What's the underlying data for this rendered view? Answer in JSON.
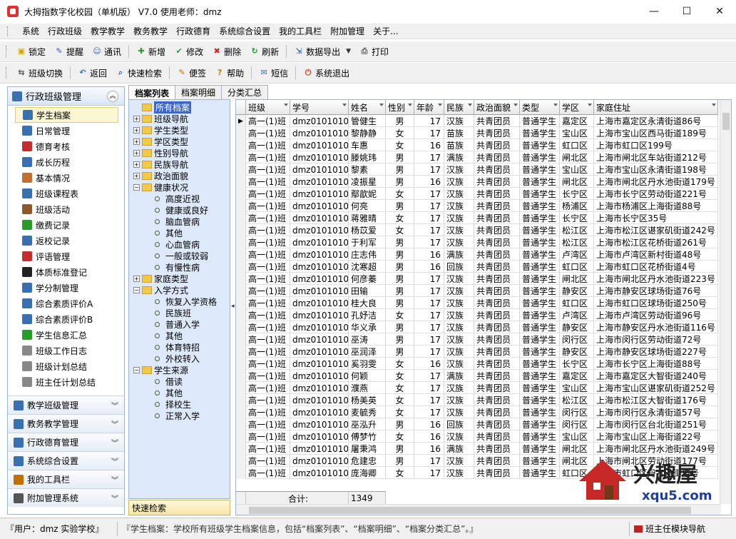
{
  "window": {
    "title": "大拇指数字化校园（单机版）  V7.0  使用老师：dmz",
    "controls": {
      "minimize": "—",
      "maximize": "☐",
      "close": "✕"
    }
  },
  "menu": [
    "系统",
    "行政班级",
    "教学教学",
    "教务教学",
    "行政德育",
    "系统综合设置",
    "我的工具栏",
    "附加管理",
    "关于..."
  ],
  "toolbar1": [
    {
      "label": "锁定",
      "icon": "lock-icon",
      "color": "#d9a400",
      "glyph": "▣"
    },
    {
      "label": "提醒",
      "icon": "reminder-icon",
      "color": "#3060c0",
      "glyph": "✎"
    },
    {
      "label": "通讯",
      "icon": "contacts-icon",
      "color": "#3060c0",
      "glyph": "☺"
    },
    {
      "label": "新增",
      "icon": "add-icon",
      "color": "#2a9a2a",
      "glyph": "✚"
    },
    {
      "label": "修改",
      "icon": "edit-icon",
      "color": "#2a9a2a",
      "glyph": "✔"
    },
    {
      "label": "删除",
      "icon": "delete-icon",
      "color": "#d02020",
      "glyph": "✖"
    },
    {
      "label": "刷新",
      "icon": "refresh-icon",
      "color": "#2a9a2a",
      "glyph": "↻"
    },
    {
      "label": "数据导出",
      "icon": "export-icon",
      "color": "#3a6fb0",
      "glyph": "⇲"
    },
    {
      "label": "打印",
      "icon": "print-icon",
      "color": "#555555",
      "glyph": "⎙"
    }
  ],
  "toolbar2": [
    {
      "label": "班级切换",
      "icon": "class-switch-icon",
      "color": "#555555",
      "glyph": "⇆"
    },
    {
      "label": "返回",
      "icon": "back-icon",
      "color": "#3a6fb0",
      "glyph": "↶"
    },
    {
      "label": "快速检索",
      "icon": "search-icon",
      "color": "#3a6fb0",
      "glyph": "⌕"
    },
    {
      "label": "便签",
      "icon": "note-icon",
      "color": "#c07000",
      "glyph": "✎"
    },
    {
      "label": "帮助",
      "icon": "help-icon",
      "color": "#c08000",
      "glyph": "?"
    },
    {
      "label": "短信",
      "icon": "sms-icon",
      "color": "#3a6fb0",
      "glyph": "✉"
    },
    {
      "label": "系统退出",
      "icon": "exit-icon",
      "color": "#d04010",
      "glyph": "⏻"
    }
  ],
  "sidebar": {
    "header": "行政班级管理",
    "items": [
      {
        "label": "学生档案",
        "icon": "student-file-icon",
        "color": "#3a6fb0"
      },
      {
        "label": "日常管理",
        "icon": "clock-icon",
        "color": "#3a6fb0"
      },
      {
        "label": "德育考核",
        "icon": "moral-check-icon",
        "color": "#c03030"
      },
      {
        "label": "成长历程",
        "icon": "growth-icon",
        "color": "#3a6fb0"
      },
      {
        "label": "基本情况",
        "icon": "basic-info-icon",
        "color": "#c07030"
      },
      {
        "label": "班级课程表",
        "icon": "timetable-icon",
        "color": "#3a6fb0"
      },
      {
        "label": "班级活动",
        "icon": "activity-icon",
        "color": "#8a5a2a"
      },
      {
        "label": "缴费记录",
        "icon": "payment-icon",
        "color": "#2a9a2a"
      },
      {
        "label": "返校记录",
        "icon": "return-school-icon",
        "color": "#3a6fb0"
      },
      {
        "label": "评语管理",
        "icon": "comment-icon",
        "color": "#c03030"
      },
      {
        "label": "体质标准登记",
        "icon": "soccer-icon",
        "color": "#222222"
      },
      {
        "label": "学分制管理",
        "icon": "credit-icon",
        "color": "#3a6fb0"
      },
      {
        "label": "综合素质评价A",
        "icon": "evaluation-a-icon",
        "color": "#3a6fb0"
      },
      {
        "label": "综合素质评价B",
        "icon": "evaluation-b-icon",
        "color": "#3a6fb0"
      },
      {
        "label": "学生信息汇总",
        "icon": "summary-icon",
        "color": "#2a9a2a"
      },
      {
        "label": "班级工作日志",
        "icon": "log-icon",
        "color": "#888888"
      },
      {
        "label": "班级计划总结",
        "icon": "plan-icon",
        "color": "#888888"
      },
      {
        "label": "班主任计划总结",
        "icon": "teacher-plan-icon",
        "color": "#888888"
      }
    ],
    "sections": [
      {
        "label": "教学班级管理",
        "icon": "teaching-class-icon",
        "color": "#3a6fb0"
      },
      {
        "label": "教务教学管理",
        "icon": "academic-icon",
        "color": "#3a6fb0"
      },
      {
        "label": "行政德育管理",
        "icon": "moral-admin-icon",
        "color": "#3a6fb0"
      },
      {
        "label": "系统综合设置",
        "icon": "settings-icon",
        "color": "#3a6fb0"
      },
      {
        "label": "我的工具栏",
        "icon": "toolbar-icon",
        "color": "#c07000"
      },
      {
        "label": "附加管理系统",
        "icon": "addon-icon",
        "color": "#555555"
      }
    ]
  },
  "tabs": [
    "档案列表",
    "档案明细",
    "分类汇总"
  ],
  "tree": [
    {
      "label": "所有档案",
      "level": 0,
      "type": "folder",
      "exp": "",
      "selected": true
    },
    {
      "label": "班级导航",
      "level": 0,
      "type": "folder",
      "exp": "+"
    },
    {
      "label": "学生类型",
      "level": 0,
      "type": "folder",
      "exp": "+"
    },
    {
      "label": "学区类型",
      "level": 0,
      "type": "folder",
      "exp": "+"
    },
    {
      "label": "性别导航",
      "level": 0,
      "type": "folder",
      "exp": "+"
    },
    {
      "label": "民族导航",
      "level": 0,
      "type": "folder",
      "exp": "+"
    },
    {
      "label": "政治面貌",
      "level": 0,
      "type": "folder",
      "exp": "+"
    },
    {
      "label": "健康状况",
      "level": 0,
      "type": "folder",
      "exp": "−"
    },
    {
      "label": "高度近视",
      "level": 1,
      "type": "leaf"
    },
    {
      "label": "健康或良好",
      "level": 1,
      "type": "leaf"
    },
    {
      "label": "脑血管病",
      "level": 1,
      "type": "leaf"
    },
    {
      "label": "其他",
      "level": 1,
      "type": "leaf"
    },
    {
      "label": "心血管病",
      "level": 1,
      "type": "leaf"
    },
    {
      "label": "一般或较弱",
      "level": 1,
      "type": "leaf"
    },
    {
      "label": "有慢性病",
      "level": 1,
      "type": "leaf"
    },
    {
      "label": "家庭类型",
      "level": 0,
      "type": "folder",
      "exp": "+"
    },
    {
      "label": "入学方式",
      "level": 0,
      "type": "folder",
      "exp": "−"
    },
    {
      "label": "恢复入学资格",
      "level": 1,
      "type": "leaf"
    },
    {
      "label": "民族班",
      "level": 1,
      "type": "leaf"
    },
    {
      "label": "普通入学",
      "level": 1,
      "type": "leaf"
    },
    {
      "label": "其他",
      "level": 1,
      "type": "leaf"
    },
    {
      "label": "体育特招",
      "level": 1,
      "type": "leaf"
    },
    {
      "label": "外校转入",
      "level": 1,
      "type": "leaf"
    },
    {
      "label": "学生来源",
      "level": 0,
      "type": "folder",
      "exp": "−"
    },
    {
      "label": "借读",
      "level": 1,
      "type": "leaf"
    },
    {
      "label": "其他",
      "level": 1,
      "type": "leaf"
    },
    {
      "label": "择校生",
      "level": 1,
      "type": "leaf"
    },
    {
      "label": "正常入学",
      "level": 1,
      "type": "leaf"
    }
  ],
  "quick_search": "快速检索",
  "grid": {
    "columns": [
      {
        "key": "cls",
        "label": "班级",
        "w": 62
      },
      {
        "key": "id",
        "label": "学号",
        "w": 82
      },
      {
        "key": "name",
        "label": "姓名",
        "w": 52
      },
      {
        "key": "sex",
        "label": "性别",
        "w": 40
      },
      {
        "key": "age",
        "label": "年龄",
        "w": 42
      },
      {
        "key": "eth",
        "label": "民族",
        "w": 42
      },
      {
        "key": "pol",
        "label": "政治面貌",
        "w": 64
      },
      {
        "key": "type",
        "label": "类型",
        "w": 56
      },
      {
        "key": "dist",
        "label": "学区",
        "w": 48
      },
      {
        "key": "addr",
        "label": "家庭住址",
        "w": 174
      }
    ],
    "rows": [
      [
        "高一(1)班",
        "dmz010101001",
        "管健生",
        "男",
        "17",
        "汉族",
        "共青团员",
        "普通学生",
        "嘉定区",
        "上海市嘉定区永清街道86号"
      ],
      [
        "高一(1)班",
        "dmz010101002",
        "黎静静",
        "女",
        "17",
        "苗族",
        "共青团员",
        "普通学生",
        "宝山区",
        "上海市宝山区西马街道189号"
      ],
      [
        "高一(1)班",
        "dmz010101003",
        "车惠",
        "女",
        "16",
        "苗族",
        "共青团员",
        "普通学生",
        "虹口区",
        "上海市虹口区199号"
      ],
      [
        "高一(1)班",
        "dmz010101004",
        "滕姚玮",
        "男",
        "17",
        "满族",
        "共青团员",
        "普通学生",
        "闸北区",
        "上海市闸北区车站街道212号"
      ],
      [
        "高一(1)班",
        "dmz010101005",
        "黎素",
        "男",
        "17",
        "汉族",
        "共青团员",
        "普通学生",
        "宝山区",
        "上海市宝山区永清街道198号"
      ],
      [
        "高一(1)班",
        "dmz010101006",
        "凌振星",
        "男",
        "16",
        "汉族",
        "共青团员",
        "普通学生",
        "闸北区",
        "上海市闸北区丹水池街道179号"
      ],
      [
        "高一(1)班",
        "dmz010101007",
        "鄢歆妮",
        "女",
        "17",
        "汉族",
        "共青团员",
        "普通学生",
        "长宁区",
        "上海市长宁区劳动街道221号"
      ],
      [
        "高一(1)班",
        "dmz010101008",
        "何亮",
        "男",
        "17",
        "汉族",
        "共青团员",
        "普通学生",
        "杨浦区",
        "上海市杨浦区上海街道88号"
      ],
      [
        "高一(1)班",
        "dmz010101009",
        "蒋雅晴",
        "女",
        "17",
        "汉族",
        "共青团员",
        "普通学生",
        "长宁区",
        "上海市长宁区35号"
      ],
      [
        "高一(1)班",
        "dmz010101010",
        "杨苡爱",
        "女",
        "17",
        "汉族",
        "共青团员",
        "普通学生",
        "松江区",
        "上海市松江区谌家矶街道242号"
      ],
      [
        "高一(1)班",
        "dmz010101011",
        "于利军",
        "男",
        "17",
        "汉族",
        "共青团员",
        "普通学生",
        "松江区",
        "上海市松江区花桥街道261号"
      ],
      [
        "高一(1)班",
        "dmz010101012",
        "庄志伟",
        "男",
        "16",
        "满族",
        "共青团员",
        "普通学生",
        "卢湾区",
        "上海市卢湾区新村街道48号"
      ],
      [
        "高一(1)班",
        "dmz010101013",
        "沈寒超",
        "男",
        "16",
        "回族",
        "共青团员",
        "普通学生",
        "虹口区",
        "上海市虹口区花桥街道4号"
      ],
      [
        "高一(1)班",
        "dmz010101014",
        "何彦蓁",
        "男",
        "17",
        "汉族",
        "共青团员",
        "普通学生",
        "闸北区",
        "上海市闸北区丹水池街道223号"
      ],
      [
        "高一(1)班",
        "dmz010101015",
        "田输",
        "男",
        "17",
        "汉族",
        "共青团员",
        "普通学生",
        "静安区",
        "上海市静安区球场街道76号"
      ],
      [
        "高一(1)班",
        "dmz010101016",
        "桂大良",
        "男",
        "17",
        "汉族",
        "共青团员",
        "普通学生",
        "虹口区",
        "上海市虹口区球场街道250号"
      ],
      [
        "高一(1)班",
        "dmz010101017",
        "孔妤洁",
        "女",
        "17",
        "汉族",
        "共青团员",
        "普通学生",
        "卢湾区",
        "上海市卢湾区劳动街道96号"
      ],
      [
        "高一(1)班",
        "dmz010101018",
        "华义承",
        "男",
        "17",
        "汉族",
        "共青团员",
        "普通学生",
        "静安区",
        "上海市静安区丹水池街道116号"
      ],
      [
        "高一(1)班",
        "dmz010101019",
        "巫涛",
        "男",
        "17",
        "汉族",
        "共青团员",
        "普通学生",
        "闵行区",
        "上海市闵行区劳动街道72号"
      ],
      [
        "高一(1)班",
        "dmz010101020",
        "巫润泽",
        "男",
        "17",
        "汉族",
        "共青团员",
        "普通学生",
        "静安区",
        "上海市静安区球场街道227号"
      ],
      [
        "高一(1)班",
        "dmz010101021",
        "奚羽雯",
        "女",
        "16",
        "汉族",
        "共青团员",
        "普通学生",
        "长宁区",
        "上海市长宁区上海街道88号"
      ],
      [
        "高一(1)班",
        "dmz010101022",
        "何颖",
        "女",
        "17",
        "满族",
        "共青团员",
        "普通学生",
        "嘉定区",
        "上海市嘉定区大智街道240号"
      ],
      [
        "高一(1)班",
        "dmz010101023",
        "濮燕",
        "女",
        "17",
        "汉族",
        "共青团员",
        "普通学生",
        "宝山区",
        "上海市宝山区谌家矶街道252号"
      ],
      [
        "高一(1)班",
        "dmz010101024",
        "杨美英",
        "女",
        "17",
        "汉族",
        "共青团员",
        "普通学生",
        "松江区",
        "上海市松江区大智街道176号"
      ],
      [
        "高一(1)班",
        "dmz010101025",
        "麦毓秀",
        "女",
        "17",
        "汉族",
        "共青团员",
        "普通学生",
        "闵行区",
        "上海市闵行区永清街道57号"
      ],
      [
        "高一(1)班",
        "dmz010101026",
        "巫泓升",
        "男",
        "16",
        "回族",
        "共青团员",
        "普通学生",
        "闵行区",
        "上海市闵行区台北街道251号"
      ],
      [
        "高一(1)班",
        "dmz010101027",
        "傅梦竹",
        "女",
        "16",
        "汉族",
        "共青团员",
        "普通学生",
        "宝山区",
        "上海市宝山区上海街道22号"
      ],
      [
        "高一(1)班",
        "dmz010101028",
        "屠秉鸿",
        "男",
        "16",
        "满族",
        "共青团员",
        "普通学生",
        "闸北区",
        "上海市闸北区丹水池街道249号"
      ],
      [
        "高一(1)班",
        "dmz010101029",
        "危建忠",
        "男",
        "17",
        "汉族",
        "共青团员",
        "普通学生",
        "闸北区",
        "上海市闸北区劳动街道177号"
      ],
      [
        "高一(1)班",
        "dmz010101030",
        "庞海卿",
        "女",
        "17",
        "汉族",
        "共青团员",
        "普通学生",
        "虹口区",
        "上海市虹口区丹水池街道号"
      ]
    ],
    "footer": {
      "label": "合计:",
      "count": "1349"
    }
  },
  "status": {
    "user": "『用户：dmz 实验学校』",
    "message": "『学生档案：学校所有班级学生档案信息，包括“档案列表”、“档案明细”、“档案分类汇总”。』",
    "nav": "班主任模块导航"
  },
  "watermark": {
    "brand": "兴趣屋",
    "url": "xqu5.com"
  }
}
